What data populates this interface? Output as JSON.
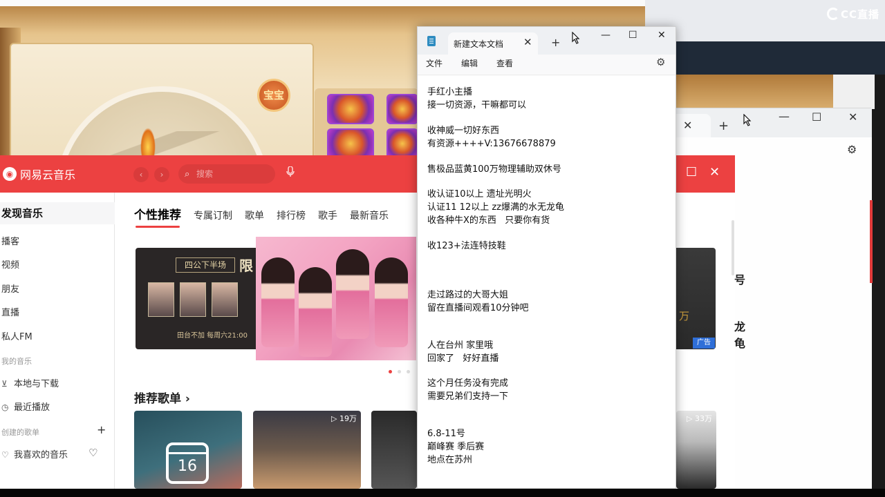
{
  "overlay": {
    "brand": "CC直播"
  },
  "game": {
    "medal_label": "宝宝"
  },
  "music": {
    "app_name": "网易云音乐",
    "logo_glyph": "◉",
    "search_placeholder": "搜索",
    "nav_back": "‹",
    "nav_forward": "›",
    "sidebar": {
      "active": "发现音乐",
      "items": [
        "播客",
        "视频",
        "朋友",
        "直播",
        "私人FM"
      ],
      "my_music_label": "我的音乐",
      "my_music_items": [
        "本地与下载",
        "最近播放"
      ],
      "created_label": "创建的歌单",
      "created_items": [
        "我喜欢的音乐"
      ],
      "add_glyph": "+"
    },
    "tabs": [
      "个性推荐",
      "专属订制",
      "歌单",
      "排行榜",
      "歌手",
      "最新音乐"
    ],
    "banner_left": {
      "tag": "四公下半场",
      "big": "限",
      "footer": "田台不加 每周六21:00"
    },
    "banner_right": {
      "text": "万",
      "ad_badge": "广告"
    },
    "section_title": "推荐歌单 ›",
    "calendar_day": "16",
    "card_counts": [
      "▷ 19万",
      "▷ 33万"
    ],
    "right_fragments": [
      "号",
      "龙龟"
    ]
  },
  "notepad": {
    "tab_title": "新建文本文档",
    "menu": [
      "文件",
      "编辑",
      "查看"
    ],
    "lines": [
      "手红小主播",
      "接一切资源，干嘛都可以",
      "收神威一切好东西",
      "有资源++++V:13676678879",
      "售极品蓝黄100万物理辅助双休号",
      "收认证10以上 遗址光明火",
      "认证11 12以上 zz爆满的水无龙龟",
      "收各种牛X的东西   只要你有货",
      "收123+法连特技鞋",
      "走过路过的大哥大姐",
      "留在直播间观看10分钟吧",
      "人在台州 家里哦",
      "回家了   好好直播",
      "这个月任务没有完成",
      "需要兄弟们支持一下",
      "6.8-11号",
      "巅峰赛 季后赛",
      "地点在苏州"
    ]
  },
  "icons": {
    "close": "✕",
    "minimize": "—",
    "maximize": "☐",
    "add": "+",
    "gear": "⚙",
    "search": "⌕",
    "mic": "🎙",
    "heart": "♡",
    "download": "⊻",
    "clock": "◷"
  }
}
